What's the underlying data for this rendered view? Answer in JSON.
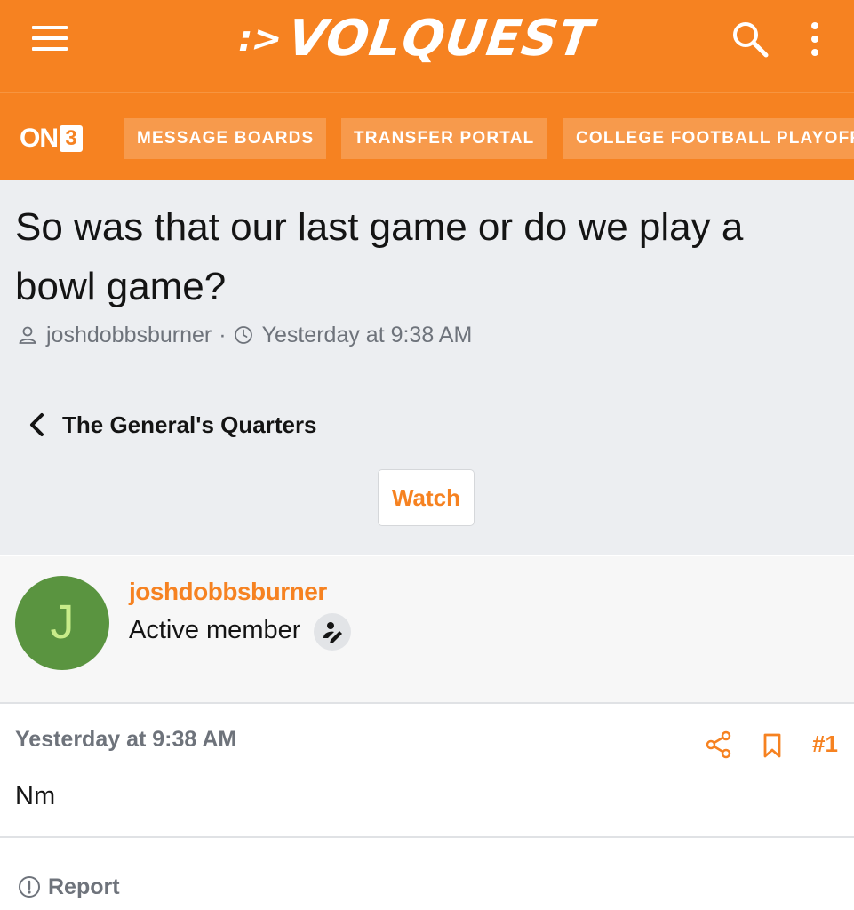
{
  "header": {
    "site_name": "VOLQUEST",
    "logo_mark": ":>",
    "menu_icon": "hamburger-menu-icon",
    "search_icon": "search-icon",
    "more_icon": "vertical-dots-icon",
    "brand_color": "#f68221"
  },
  "nav": {
    "network_logo": "ON3",
    "items": [
      {
        "label": "MESSAGE BOARDS"
      },
      {
        "label": "TRANSFER PORTAL"
      },
      {
        "label": "COLLEGE FOOTBALL PLAYOFF"
      }
    ]
  },
  "thread": {
    "title": "So was that our last game or do we play a bowl game?",
    "author": "joshdobbsburner",
    "separator": "·",
    "timestamp": "Yesterday at 9:38 AM",
    "forum": "The General's Quarters",
    "watch_label": "Watch"
  },
  "post": {
    "avatar_letter": "J",
    "avatar_color": "#5a9440",
    "username": "joshdobbsburner",
    "user_title": "Active member",
    "role_icon": "user-edit-icon",
    "date": "Yesterday at 9:38 AM",
    "number": "#1",
    "body": "Nm",
    "report_label": "Report"
  }
}
